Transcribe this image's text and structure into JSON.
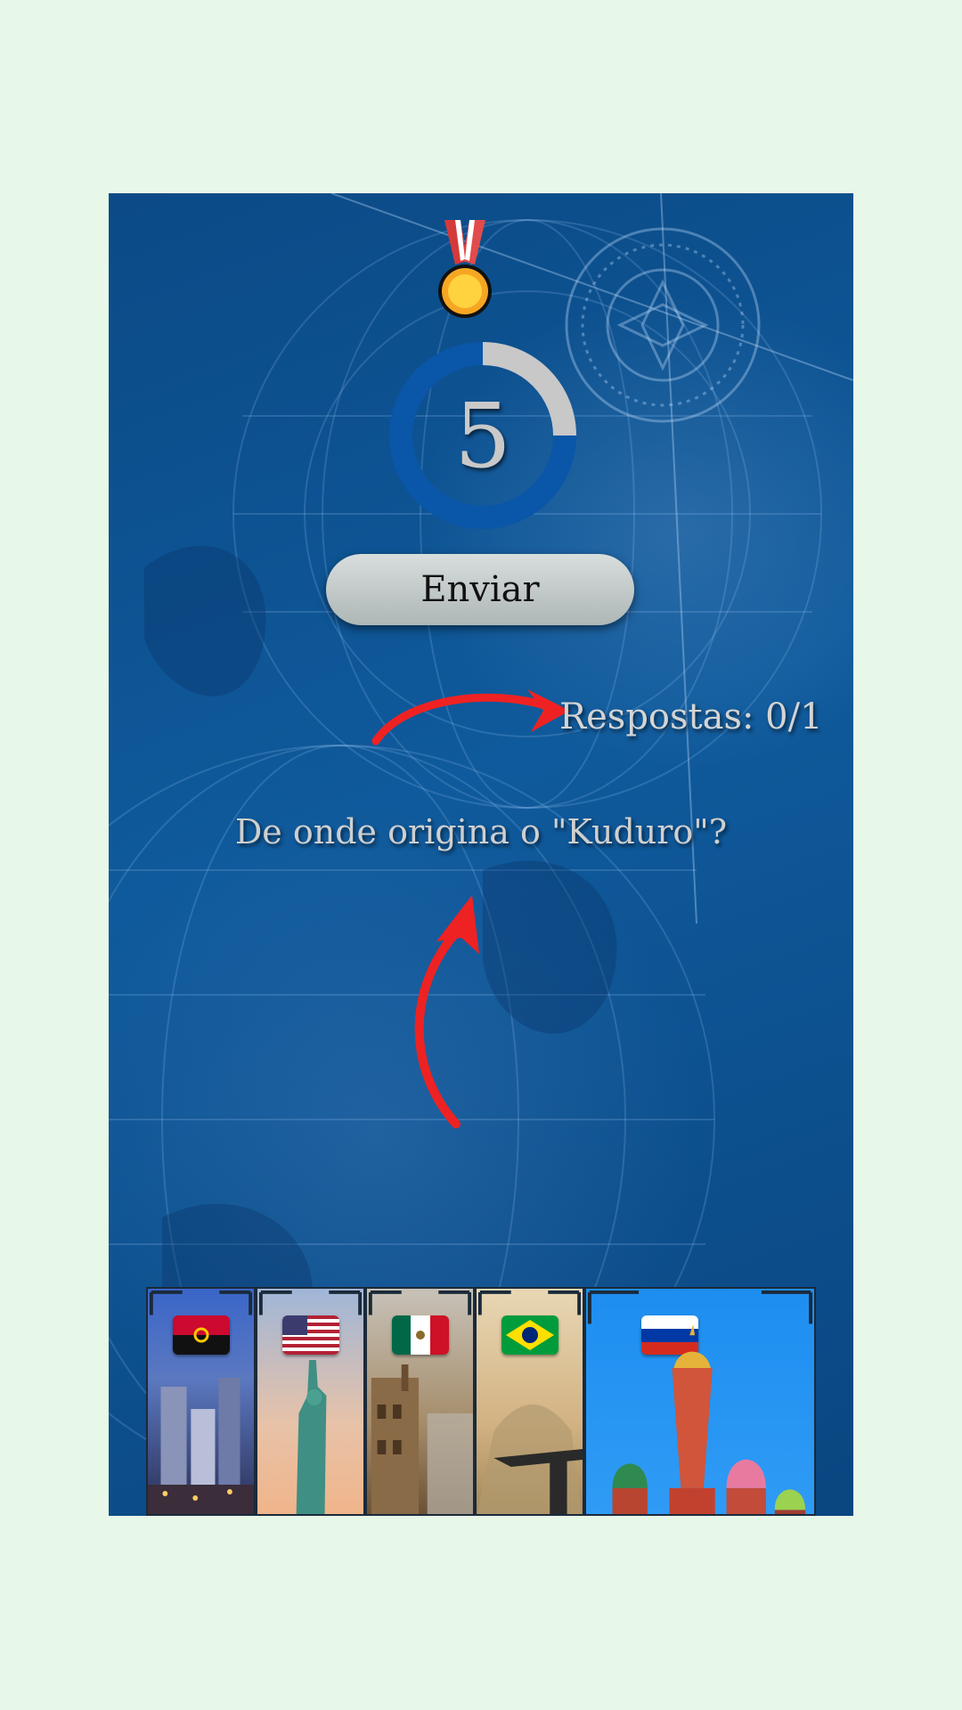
{
  "timer": {
    "value": "5",
    "progress_remaining": 0.75
  },
  "submit": {
    "label": "Enviar"
  },
  "answers": {
    "label": "Respostas: 0/1"
  },
  "question": {
    "text": "De onde origina o \"Kuduro\"?"
  },
  "cards": [
    {
      "name": "card-angola",
      "flag": "angola-flag-icon",
      "scene": "city-skyline"
    },
    {
      "name": "card-usa",
      "flag": "usa-flag-icon",
      "scene": "statue-of-liberty"
    },
    {
      "name": "card-mexico",
      "flag": "mexico-flag-icon",
      "scene": "colonial-buildings"
    },
    {
      "name": "card-brazil",
      "flag": "brazil-flag-icon",
      "scene": "christ-the-redeemer"
    },
    {
      "name": "card-russia",
      "flag": "russia-flag-icon",
      "scene": "st-basils-cathedral",
      "selected": true
    }
  ],
  "colors": {
    "accent_red": "#ee2222",
    "timer_track": "#0a56a8",
    "timer_fill": "#c8c8c8"
  }
}
